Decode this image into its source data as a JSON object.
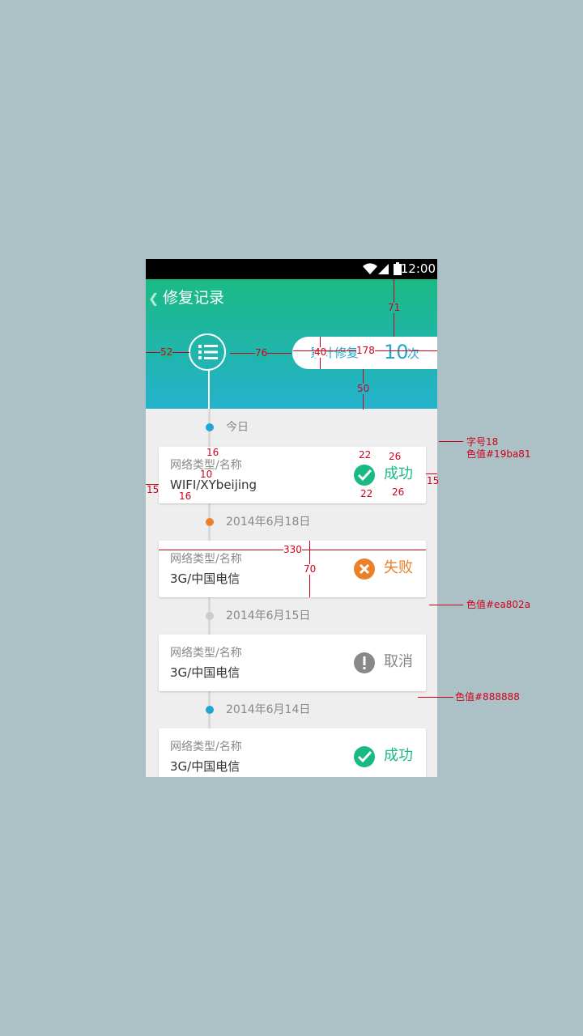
{
  "status_bar": {
    "time": "12:00"
  },
  "header": {
    "title": "修复记录",
    "summary_label": "累计修复",
    "summary_value": "10",
    "summary_unit": "次"
  },
  "colors": {
    "success": "#19ba81",
    "failure": "#ea802a",
    "cancel": "#888888",
    "timeline_today": "#25a2d6"
  },
  "entries": [
    {
      "date": "今日",
      "dot_color": "#25a2d6",
      "label": "网络类型/名称",
      "value": "WIFI/XYbeijing",
      "status": "成功",
      "status_type": "success"
    },
    {
      "date": "2014年6月18日",
      "dot_color": "#ea802a",
      "label": "网络类型/名称",
      "value": "3G/中国电信",
      "status": "失败",
      "status_type": "failure"
    },
    {
      "date": "2014年6月15日",
      "dot_color": "#cccccc",
      "label": "网络类型/名称",
      "value": "3G/中国电信",
      "status": "取消",
      "status_type": "cancel"
    },
    {
      "date": "2014年6月14日",
      "dot_color": "#25a2d6",
      "label": "网络类型/名称",
      "value": "3G/中国电信",
      "status": "成功",
      "status_type": "success"
    }
  ],
  "annotations": {
    "font_size_note": "字号18",
    "color_success_note": "色值#19ba81",
    "color_failure_note": "色值#ea802a",
    "color_cancel_note": "色值#888888",
    "dim_52": "52",
    "dim_76": "76",
    "dim_40": "40",
    "dim_178": "178",
    "dim_71": "71",
    "dim_50": "50",
    "dim_16a": "16",
    "dim_10": "10",
    "dim_15a": "15",
    "dim_16b": "16",
    "dim_22a": "22",
    "dim_26a": "26",
    "dim_22b": "22",
    "dim_26b": "26",
    "dim_15b": "15",
    "dim_330": "330",
    "dim_70": "70"
  }
}
